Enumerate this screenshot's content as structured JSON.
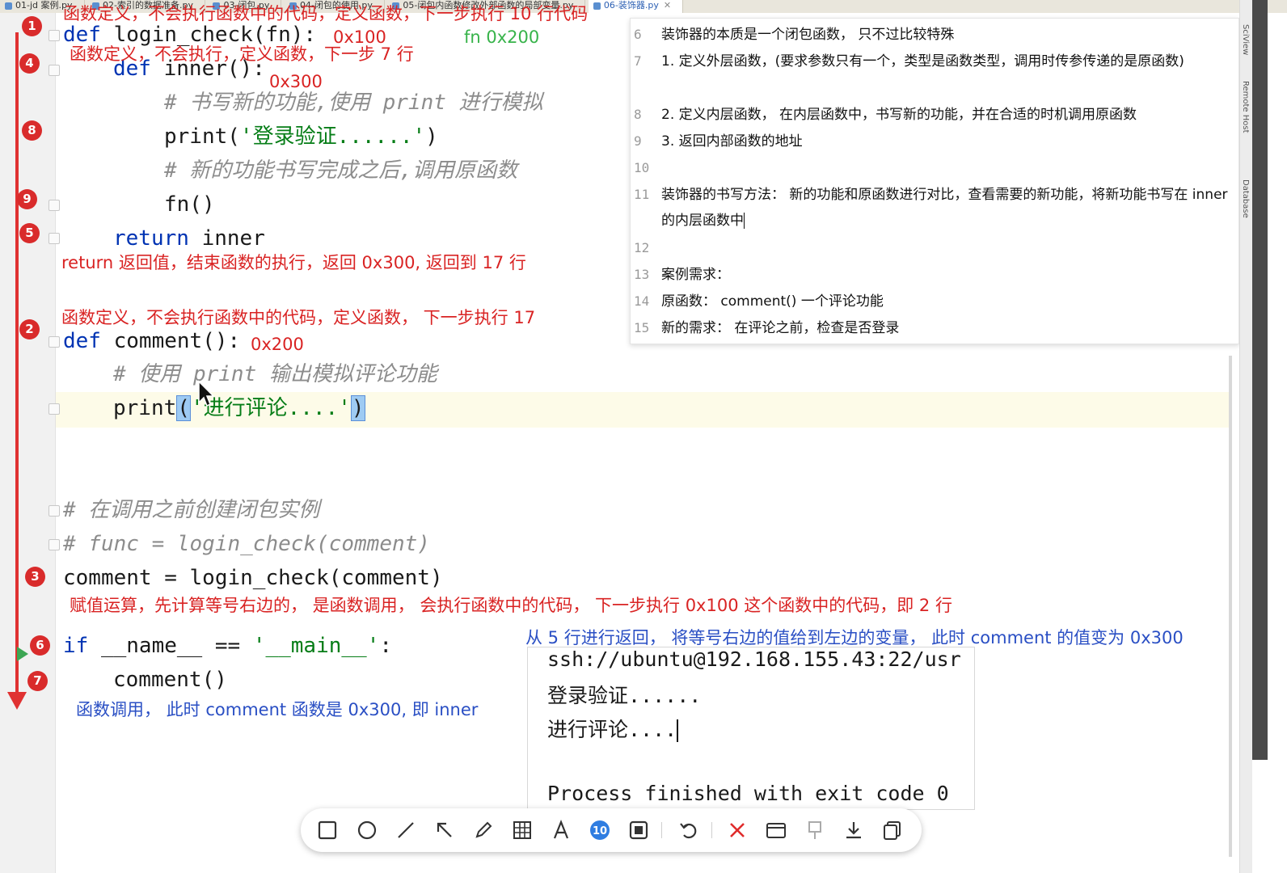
{
  "tabs": [
    {
      "label": "01-jd 案例.py",
      "active": false
    },
    {
      "label": "02-索引的数据准备.py",
      "active": false
    },
    {
      "label": "03-闭包.py",
      "active": false
    },
    {
      "label": "04-闭包的使用.py",
      "active": false
    },
    {
      "label": "05-闭包内函数修改外部函数的局部变量.py",
      "active": false
    },
    {
      "label": "06-装饰器.py",
      "active": true
    }
  ],
  "step_badges": [
    "1",
    "4",
    "8",
    "9",
    "5",
    "2",
    "3",
    "6",
    "7"
  ],
  "code": {
    "l1_kw": "def",
    "l1_rest": " login_check(fn):",
    "l2_kw": "def",
    "l2_rest": " inner():",
    "l3": "# 书写新的功能,使用 print 进行模拟",
    "l4_fn": "print(",
    "l4_str": "'登录验证......'",
    "l4_end": ")",
    "l5": "# 新的功能书写完成之后,调用原函数",
    "l6": "fn()",
    "l7_kw": "return",
    "l7_rest": " inner",
    "l8_kw": "def",
    "l8_rest": " comment():",
    "l9": "# 使用 print 输出模拟评论功能",
    "l10_fn": "print",
    "l10_open": "(",
    "l10_str": "'进行评论....'",
    "l10_close": ")",
    "l11": "# 在调用之前创建闭包实例",
    "l12": "# func = login_check(comment)",
    "l13": "comment = login_check(comment)",
    "l14_kw": "if",
    "l14_mid": " __name__ == ",
    "l14_str": "'__main__'",
    "l14_end": ":",
    "l15": "comment()"
  },
  "annotations": {
    "a1": "函数定义，不会执行函数中的代码，定义函数，下一步执行 10 行代码",
    "a_0x100": "0x100",
    "a_fn": "fn 0x200",
    "a2": "函数定义，不会执行，定义函数，下一步 7 行",
    "a_0x300": "0x300",
    "a3": "return 返回值，结束函数的执行，返回 0x300, 返回到 17 行",
    "a4": "函数定义，不会执行函数中的代码，定义函数，  下一步执行 17",
    "a_0x200": "0x200",
    "a5": "赋值运算，先计算等号右边的，  是函数调用，  会执行函数中的代码，  下一步执行 0x100 这个函数中的代码，即 2 行",
    "a6": "从 5 行进行返回，  将等号右边的值给到左边的变量，  此时 comment 的值变为 0x300",
    "a7": "函数调用，  此时 comment 函数是 0x300, 即 inner"
  },
  "notes": [
    {
      "ln": "6",
      "text": "装饰器的本质是一个闭包函数，  只不过比较特殊"
    },
    {
      "ln": "7",
      "text": "1. 定义外层函数，(要求参数只有一个，类型是函数类型，调用时传参传递的是原函数)"
    },
    {
      "ln": "8",
      "text": "2. 定义内层函数，  在内层函数中，书写新的功能，并在合适的时机调用原函数"
    },
    {
      "ln": "9",
      "text": "3. 返回内部函数的地址"
    },
    {
      "ln": "10",
      "text": ""
    },
    {
      "ln": "11",
      "text": "装饰器的书写方法：  新的功能和原函数进行对比，查看需要的新功能，将新功能书写在 inner 的内层函数中"
    },
    {
      "ln": "12",
      "text": ""
    },
    {
      "ln": "13",
      "text": "案例需求："
    },
    {
      "ln": "14",
      "text": "原函数：  comment()   一个评论功能"
    },
    {
      "ln": "15",
      "text": "新的需求：  在评论之前，检查是否登录"
    }
  ],
  "terminal": {
    "cmd": "ssh://ubuntu@192.168.155.43:22/usr",
    "out1": "登录验证......",
    "out2": "进行评论....",
    "exit": "Process finished with exit code 0"
  },
  "side_labels": [
    "SciView",
    "Remote Host",
    "Database"
  ],
  "toolbar": {
    "step_number": "10",
    "tools": [
      "rectangle",
      "ellipse",
      "line",
      "arrow",
      "pencil",
      "mosaic",
      "text",
      "step-number",
      "blur",
      "undo",
      "cancel",
      "screenshot-window",
      "pin",
      "download",
      "copy"
    ]
  },
  "colors": {
    "annotation_red": "#d92323",
    "annotation_blue": "#2a4fc4",
    "annotation_green": "#37b34a",
    "keyword": "#0033b3",
    "string": "#067d17",
    "comment": "#8c8c8c"
  }
}
